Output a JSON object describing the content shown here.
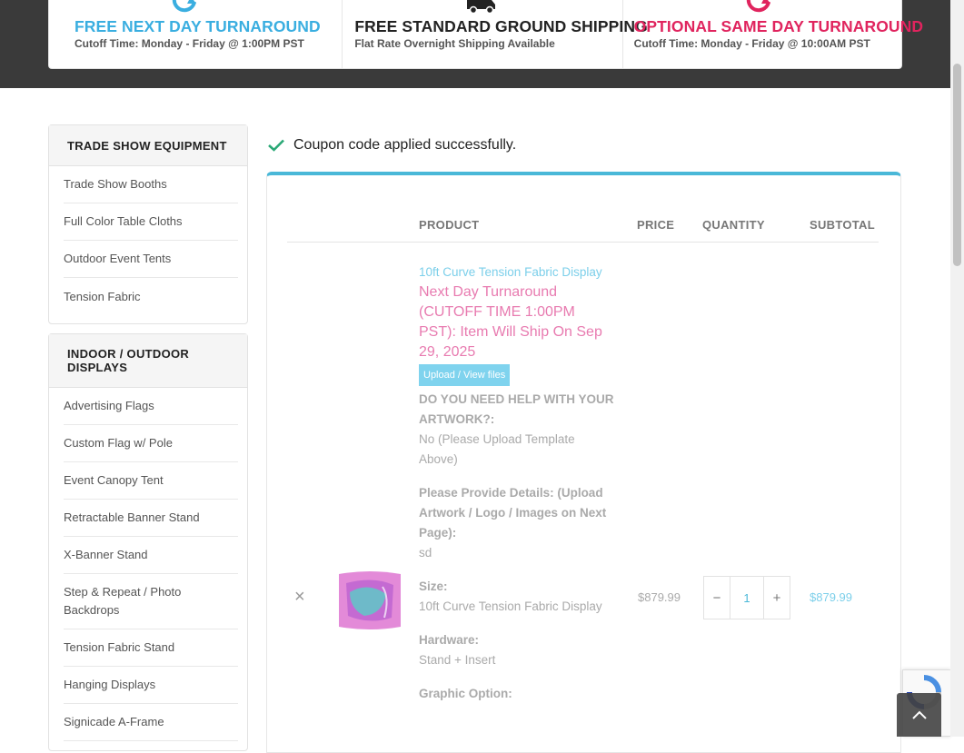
{
  "shipping": [
    {
      "title": "FREE NEXT DAY TURNAROUND",
      "subtitle": "Cutoff Time: Monday - Friday @ 1:00PM PST",
      "color": "#3aaee0",
      "icon": "refresh-icon"
    },
    {
      "title": "FREE STANDARD GROUND SHIPPING",
      "subtitle": "Flat Rate Overnight Shipping Available",
      "color": "#222222",
      "icon": "truck-icon"
    },
    {
      "title": "OPTIONAL SAME DAY TURNAROUND",
      "subtitle": "Cutoff Time: Monday - Friday @ 10:00AM PST",
      "color": "#e0245e",
      "icon": "refresh-icon"
    }
  ],
  "sidebar": [
    {
      "heading": "TRADE SHOW EQUIPMENT",
      "items": [
        "Trade Show Booths",
        "Full Color Table Cloths",
        "Outdoor Event Tents",
        "Tension Fabric"
      ]
    },
    {
      "heading": "INDOOR / OUTDOOR DISPLAYS",
      "items": [
        "Advertising Flags",
        "Custom Flag w/ Pole",
        "Event Canopy Tent",
        "Retractable Banner Stand",
        "X-Banner Stand",
        "Step & Repeat / Photo Backdrops",
        "Tension Fabric Stand",
        "Hanging Displays",
        "Signicade A-Frame"
      ]
    }
  ],
  "notice": {
    "text": "Coupon code applied successfully."
  },
  "cart": {
    "headers": {
      "product": "PRODUCT",
      "price": "PRICE",
      "quantity": "QUANTITY",
      "subtotal": "SUBTOTAL"
    },
    "item": {
      "remove": "×",
      "name": "10ft Curve Tension Fabric Display",
      "turnaround": "Next Day Turnaround (CUTOFF TIME 1:00PM PST): Item Will Ship On Sep 29, 2025",
      "upload_label": "Upload / View files",
      "meta": [
        {
          "label": "DO YOU NEED HELP WITH YOUR ARTWORK?:",
          "value": "No (Please Upload Template Above)"
        },
        {
          "label": "Please Provide Details: (Upload Artwork / Logo / Images on Next Page):",
          "value": "sd"
        },
        {
          "label": "Size:",
          "value": "10ft Curve Tension Fabric Display"
        },
        {
          "label": "Hardware:",
          "value": "Stand + Insert"
        },
        {
          "label": "Graphic Option:",
          "value": ""
        }
      ],
      "price": "$879.99",
      "quantity": "1",
      "minus": "−",
      "plus": "+",
      "subtotal": "$879.99"
    }
  },
  "colors": {
    "accent": "#4ab8d8",
    "link": "#7ccfea",
    "turnaround": "#e87bb0"
  }
}
